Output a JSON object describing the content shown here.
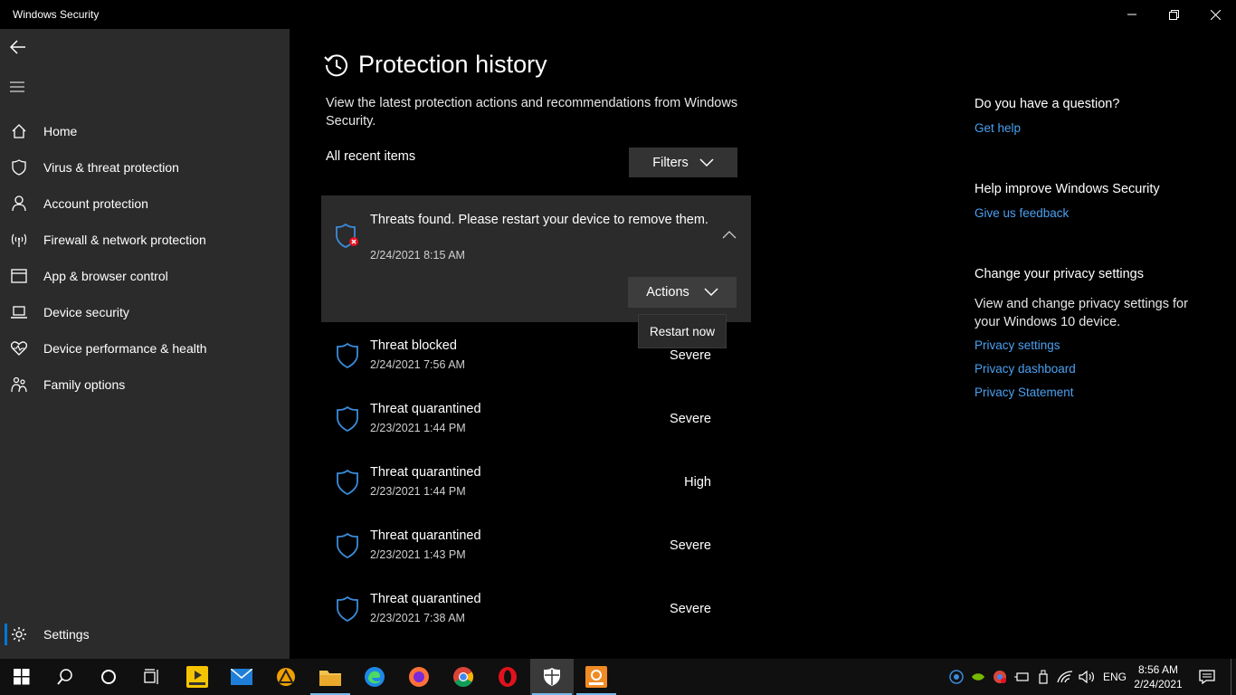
{
  "window": {
    "title": "Windows Security"
  },
  "sidebar": {
    "items": [
      {
        "label": "Home",
        "icon": "home-icon"
      },
      {
        "label": "Virus & threat protection",
        "icon": "shield-icon"
      },
      {
        "label": "Account protection",
        "icon": "person-icon"
      },
      {
        "label": "Firewall & network protection",
        "icon": "antenna-icon"
      },
      {
        "label": "App & browser control",
        "icon": "app-window-icon"
      },
      {
        "label": "Device security",
        "icon": "laptop-icon"
      },
      {
        "label": "Device performance & health",
        "icon": "heart-pulse-icon"
      },
      {
        "label": "Family options",
        "icon": "family-icon"
      }
    ],
    "settings_label": "Settings"
  },
  "main": {
    "title": "Protection history",
    "description": "View the latest protection actions and recommendations from Windows Security.",
    "all_recent": "All recent items",
    "filters_label": "Filters",
    "expanded": {
      "title": "Threats found. Please restart your device to remove them.",
      "date": "2/24/2021 8:15 AM",
      "actions_label": "Actions",
      "dropdown_option": "Restart now"
    },
    "history": [
      {
        "title": "Threat blocked",
        "date": "2/24/2021 7:56 AM",
        "severity": "Severe"
      },
      {
        "title": "Threat quarantined",
        "date": "2/23/2021 1:44 PM",
        "severity": "Severe"
      },
      {
        "title": "Threat quarantined",
        "date": "2/23/2021 1:44 PM",
        "severity": "High"
      },
      {
        "title": "Threat quarantined",
        "date": "2/23/2021 1:43 PM",
        "severity": "Severe"
      },
      {
        "title": "Threat quarantined",
        "date": "2/23/2021 7:38 AM",
        "severity": "Severe"
      }
    ]
  },
  "right": {
    "question_heading": "Do you have a question?",
    "get_help": "Get help",
    "improve_heading": "Help improve Windows Security",
    "feedback": "Give us feedback",
    "privacy_heading": "Change your privacy settings",
    "privacy_text": "View and change privacy settings for your Windows 10 device.",
    "privacy_settings": "Privacy settings",
    "privacy_dashboard": "Privacy dashboard",
    "privacy_statement": "Privacy Statement"
  },
  "taskbar": {
    "language": "ENG",
    "time": "8:56 AM",
    "date": "2/24/2021"
  },
  "colors": {
    "accent": "#0078d7",
    "link": "#4aa0f0",
    "shield_blue": "#3b8bd9",
    "alert_red": "#e81123",
    "sidebar_bg": "#2b2b2b",
    "taskbar_bg": "#101010"
  }
}
